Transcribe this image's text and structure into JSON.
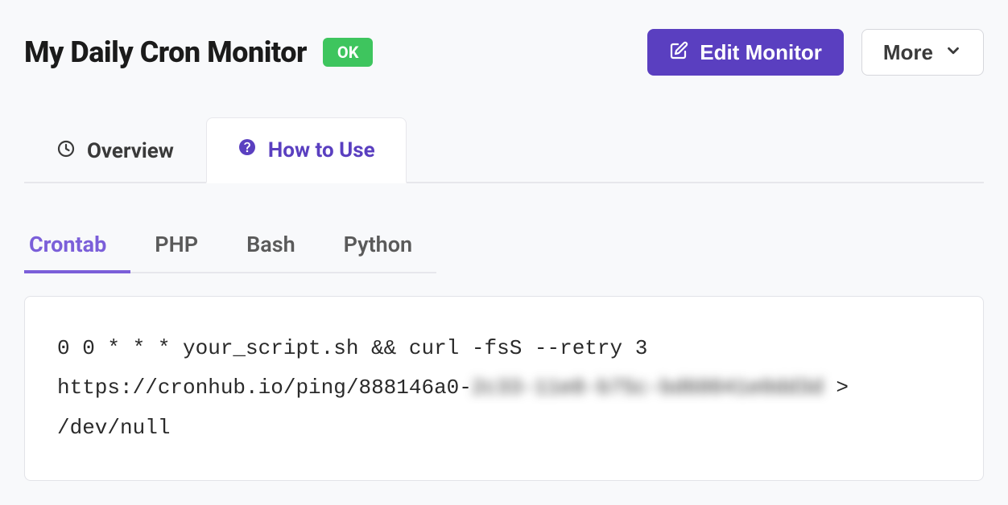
{
  "header": {
    "title": "My Daily Cron Monitor",
    "status": "OK",
    "edit_label": "Edit Monitor",
    "more_label": "More"
  },
  "tabs": {
    "primary": [
      {
        "label": "Overview",
        "active": false
      },
      {
        "label": "How to Use",
        "active": true
      }
    ],
    "sub": [
      {
        "label": "Crontab",
        "active": true
      },
      {
        "label": "PHP",
        "active": false
      },
      {
        "label": "Bash",
        "active": false
      },
      {
        "label": "Python",
        "active": false
      }
    ]
  },
  "code": {
    "prefix": "0 0 * * * your_script.sh && curl -fsS --retry 3 https://cronhub.io/ping/888146a0-",
    "redacted": "2c33-11e8-b75c-bd60041e0dd3d",
    "suffix": " > /dev/null"
  }
}
